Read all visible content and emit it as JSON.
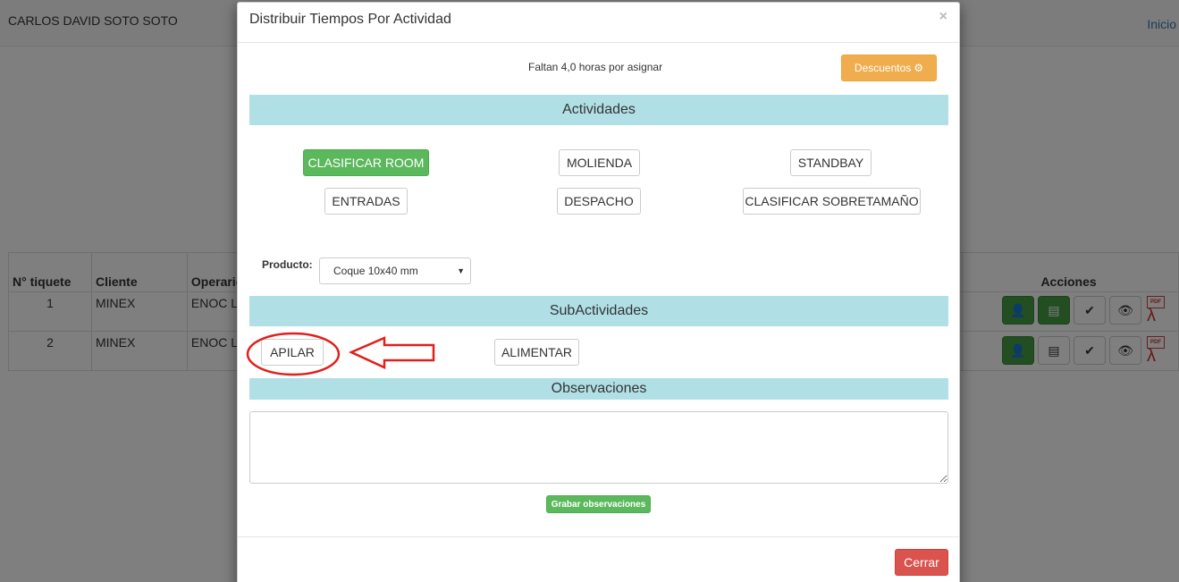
{
  "header": {
    "user_name": "CARLOS DAVID SOTO SOTO",
    "nav_inicio": "Inicio"
  },
  "table": {
    "headers": [
      "N° tiquete",
      "Cliente",
      "Operario",
      "Acciones"
    ],
    "rows": [
      {
        "num": "1",
        "cliente": "MINEX",
        "operario": "ENOC LC"
      },
      {
        "num": "2",
        "cliente": "MINEX",
        "operario": "ENOC LC"
      }
    ],
    "pdf_label": "PDF"
  },
  "modal": {
    "title": "Distribuir Tiempos Por Actividad",
    "close": "×",
    "remaining": "Faltan 4,0 horas por asignar",
    "descuentos_label": "Descuentos",
    "actividades_header": "Actividades",
    "activities": [
      "CLASIFICAR ROOM",
      "MOLIENDA",
      "STANDBAY",
      "ENTRADAS",
      "DESPACHO",
      "CLASIFICAR SOBRETAMAÑO"
    ],
    "producto_label": "Producto:",
    "producto_value": "Coque 10x40 mm",
    "subactividades_header": "SubActividades",
    "subactivities": [
      "APILAR",
      "ALIMENTAR"
    ],
    "observaciones_header": "Observaciones",
    "grabar_label": "Grabar observaciones",
    "cerrar_label": "Cerrar"
  },
  "colors": {
    "success": "#5cb85c",
    "warning": "#f0ad4e",
    "danger": "#d9534f",
    "band": "#b0e0e6",
    "annotation": "#e0201b"
  }
}
